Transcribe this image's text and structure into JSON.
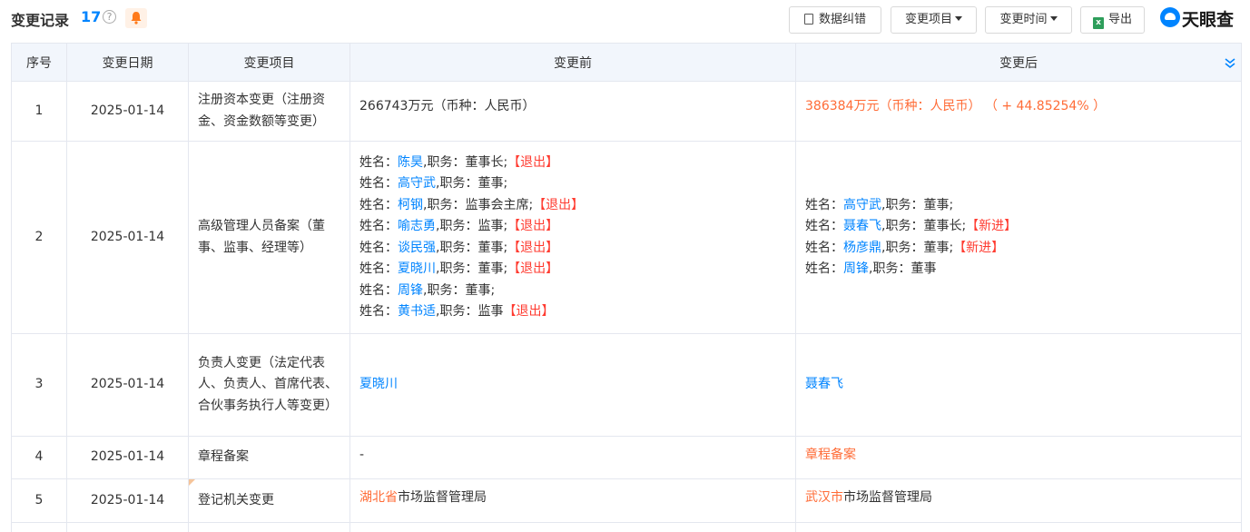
{
  "header": {
    "title": "变更记录",
    "count": "17",
    "help": "?",
    "buttons": {
      "correct": "数据纠错",
      "item": "变更项目",
      "time": "变更时间",
      "export": "导出"
    },
    "logo": "天眼查"
  },
  "table": {
    "columns": [
      "序号",
      "变更日期",
      "变更项目",
      "变更前",
      "变更后"
    ],
    "rows": [
      {
        "no": "1",
        "date": "2025-01-14",
        "item": "注册资本变更（注册资金、资金数额等变更）",
        "before": "266743万元（币种：人民币）",
        "after_value": "386384万元（币种：人民币）",
        "after_change": "（ + 44.85254% ）"
      },
      {
        "no": "2",
        "date": "2025-01-14",
        "item": "高级管理人员备案（董事、监事、经理等）",
        "before": [
          {
            "prefix": "姓名：",
            "name": "陈昊",
            "role": ",职务：董事长;",
            "tag": "【退出】"
          },
          {
            "prefix": "姓名：",
            "name": "高守武",
            "role": ",职务：董事;",
            "tag": ""
          },
          {
            "prefix": "姓名：",
            "name": "柯钢",
            "role": ",职务：监事会主席;",
            "tag": "【退出】"
          },
          {
            "prefix": "姓名：",
            "name": "喻志勇",
            "role": ",职务：监事;",
            "tag": "【退出】"
          },
          {
            "prefix": "姓名：",
            "name": "谈民强",
            "role": ",职务：董事;",
            "tag": "【退出】"
          },
          {
            "prefix": "姓名：",
            "name": "夏晓川",
            "role": ",职务：董事;",
            "tag": "【退出】"
          },
          {
            "prefix": "姓名：",
            "name": "周锋",
            "role": ",职务：董事;",
            "tag": ""
          },
          {
            "prefix": "姓名：",
            "name": "黄书适",
            "role": ",职务：监事",
            "tag": "【退出】"
          }
        ],
        "after": [
          {
            "prefix": "姓名：",
            "name": "高守武",
            "role": ",职务：董事;",
            "tag": ""
          },
          {
            "prefix": "姓名：",
            "name": "聂春飞",
            "role": ",职务：董事长;",
            "tag": "【新进】"
          },
          {
            "prefix": "姓名：",
            "name": "杨彦鼎",
            "role": ",职务：董事;",
            "tag": "【新进】"
          },
          {
            "prefix": "姓名：",
            "name": "周锋",
            "role": ",职务：董事",
            "tag": ""
          }
        ]
      },
      {
        "no": "3",
        "date": "2025-01-14",
        "item": "负责人变更（法定代表人、负责人、首席代表、合伙事务执行人等变更）",
        "before": "夏晓川",
        "after": "聂春飞"
      },
      {
        "no": "4",
        "date": "2025-01-14",
        "item": "章程备案",
        "before": "-",
        "after": "章程备案"
      },
      {
        "no": "5",
        "date": "2025-01-14",
        "item": "登记机关变更",
        "before_highlight": "湖北省",
        "before_rest": "市场监督管理局",
        "after_highlight": "武汉市",
        "after_rest": "市场监督管理局"
      }
    ]
  }
}
